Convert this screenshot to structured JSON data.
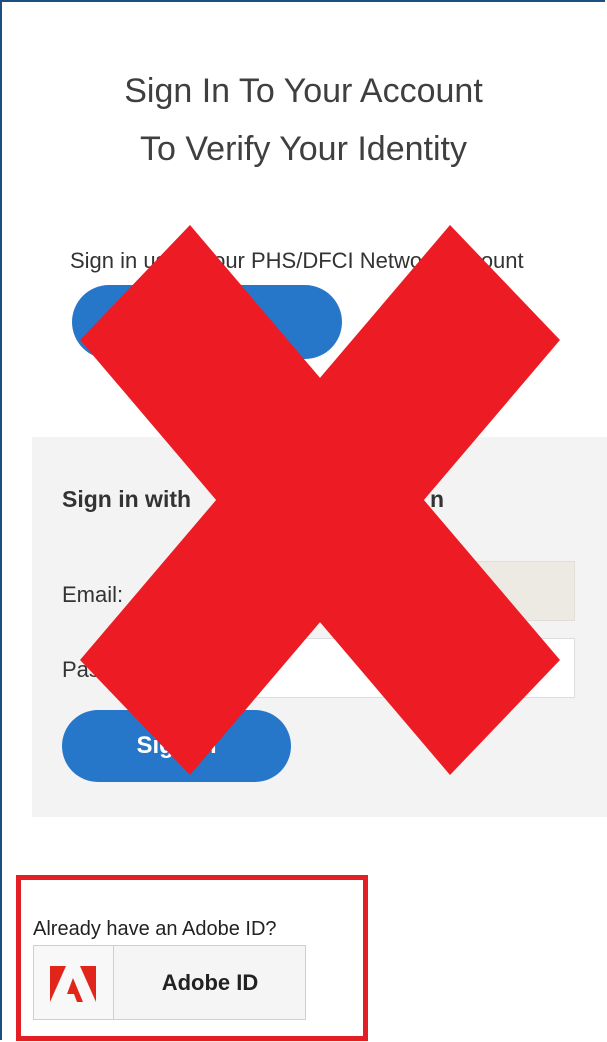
{
  "header": {
    "title_line1": "Sign In To Your Account",
    "title_line2": "To Verify Your Identity"
  },
  "network_signin": {
    "prompt_text": "Sign in using your PHS/DFCI Network account",
    "button_label": ""
  },
  "email_signin": {
    "heading": "Sign in with",
    "heading_tail": "n",
    "email_label": "Email:",
    "password_label": "Password:",
    "email_value": "",
    "password_value": "",
    "submit_label": "Sign in"
  },
  "adobe": {
    "question": "Already have an Adobe ID?",
    "button_label": "Adobe ID",
    "logo_icon": "adobe-logo-icon"
  },
  "overlay": {
    "x_icon": "red-x-icon",
    "x_color": "#ed1c24",
    "box_color": "#e31f26"
  },
  "colors": {
    "accent_blue": "#2677c9",
    "panel_bg": "#f3f3f3"
  }
}
